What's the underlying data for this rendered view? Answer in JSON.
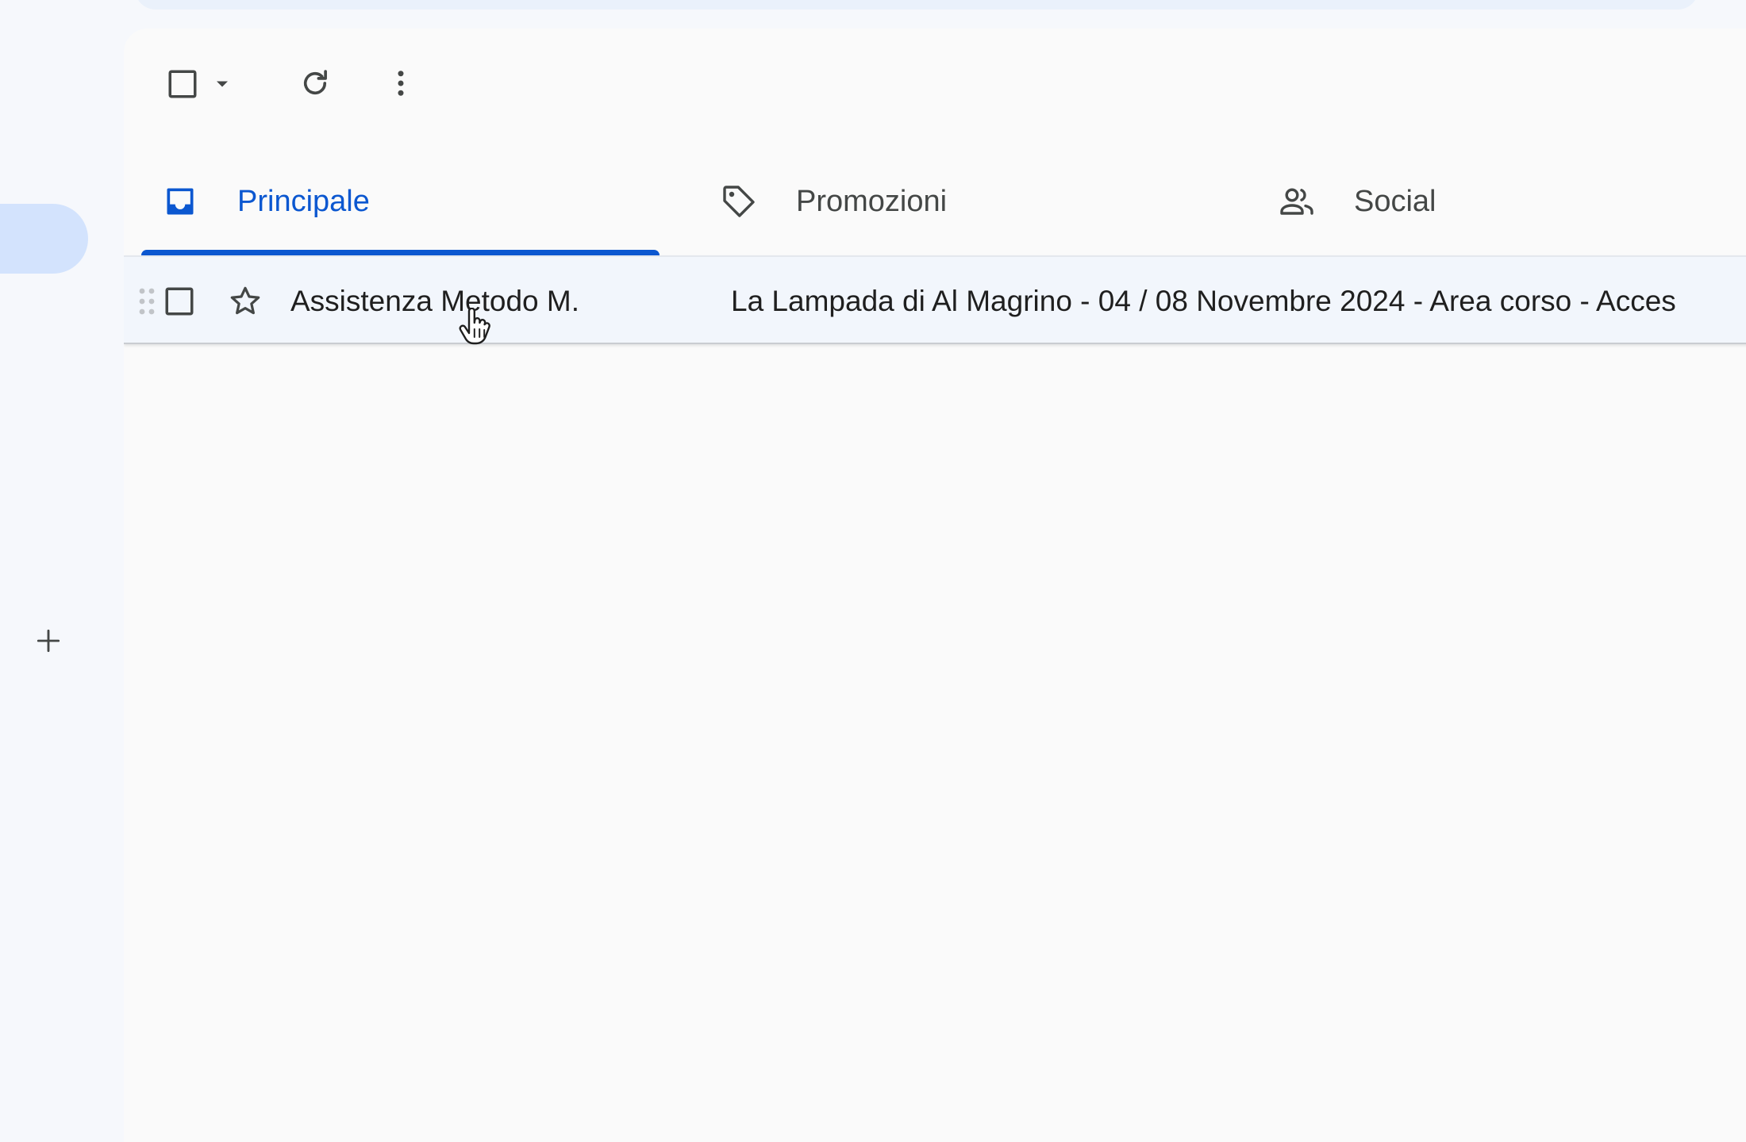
{
  "toolbar": {
    "select_icon": "checkbox-outline-icon",
    "select_menu_icon": "caret-down-icon",
    "refresh_icon": "refresh-icon",
    "more_icon": "more-vert-icon"
  },
  "tabs": [
    {
      "label": "Principale",
      "icon": "inbox-icon",
      "active": true
    },
    {
      "label": "Promozioni",
      "icon": "tag-icon",
      "active": false
    },
    {
      "label": "Social",
      "icon": "people-icon",
      "active": false
    }
  ],
  "emails": [
    {
      "sender": "Assistenza Metodo M.",
      "subject": "La Lampada di Al Magrino - 04 / 08 Novembre 2024 - Area corso - Acces",
      "starred": false,
      "hovered": true
    }
  ],
  "sidebar": {
    "add_label_icon": "plus-icon"
  },
  "colors": {
    "accent": "#0b57d0",
    "page_background": "#f6f8fc",
    "panel_background": "#fafafa",
    "row_hover_background": "#f2f6fc",
    "active_nav_pill": "#d3e3fd",
    "icon_gray": "#444746"
  }
}
